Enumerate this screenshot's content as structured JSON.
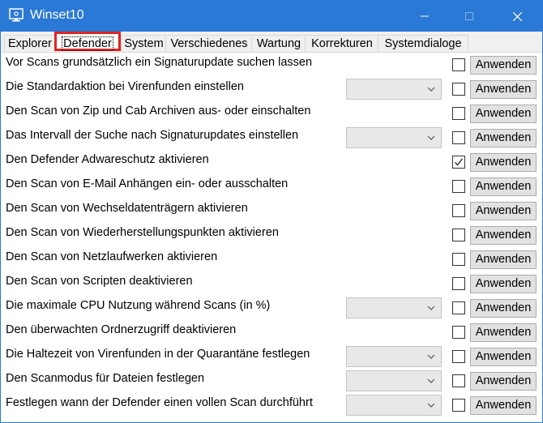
{
  "window": {
    "title": "Winset10",
    "accent_color": "#2b79d6",
    "controls": {
      "minimize": "minimize-icon",
      "maximize": "maximize-icon",
      "close": "close-icon"
    }
  },
  "tabs": [
    {
      "label": "Explorer",
      "selected": false
    },
    {
      "label": "Defender",
      "selected": true
    },
    {
      "label": "System",
      "selected": false
    },
    {
      "label": "Verschiedenes",
      "selected": false
    },
    {
      "label": "Wartung",
      "selected": false
    },
    {
      "label": "Korrekturen",
      "selected": false
    },
    {
      "label": "Systemdialoge",
      "selected": false
    }
  ],
  "highlight_color": "#e02323",
  "settings": [
    {
      "label": "Vor Scans grundsätzlich ein Signaturupdate suchen lassen",
      "has_dropdown": false,
      "checked": false,
      "button": "Anwenden"
    },
    {
      "label": "Die Standardaktion bei Virenfunden einstellen",
      "has_dropdown": true,
      "checked": false,
      "button": "Anwenden"
    },
    {
      "label": "Den Scan von Zip und Cab Archiven aus- oder einschalten",
      "has_dropdown": false,
      "checked": false,
      "button": "Anwenden"
    },
    {
      "label": "Das Intervall der Suche nach Signaturupdates einstellen",
      "has_dropdown": true,
      "checked": false,
      "button": "Anwenden"
    },
    {
      "label": "Den Defender Adwareschutz aktivieren",
      "has_dropdown": false,
      "checked": true,
      "button": "Anwenden"
    },
    {
      "label": "Den Scan von E-Mail Anhängen ein- oder ausschalten",
      "has_dropdown": false,
      "checked": false,
      "button": "Anwenden"
    },
    {
      "label": "Den Scan von Wechseldatenträgern aktivieren",
      "has_dropdown": false,
      "checked": false,
      "button": "Anwenden"
    },
    {
      "label": "Den Scan von Wiederherstellungspunkten aktivieren",
      "has_dropdown": false,
      "checked": false,
      "button": "Anwenden"
    },
    {
      "label": "Den Scan von Netzlaufwerken aktivieren",
      "has_dropdown": false,
      "checked": false,
      "button": "Anwenden"
    },
    {
      "label": "Den Scan von Scripten deaktivieren",
      "has_dropdown": false,
      "checked": false,
      "button": "Anwenden"
    },
    {
      "label": "Die maximale CPU Nutzung während Scans (in %)",
      "has_dropdown": true,
      "checked": false,
      "button": "Anwenden"
    },
    {
      "label": "Den überwachten Ordnerzugriff deaktivieren",
      "has_dropdown": false,
      "checked": false,
      "button": "Anwenden"
    },
    {
      "label": "Die Haltezeit von Virenfunden in der Quarantäne festlegen",
      "has_dropdown": true,
      "checked": false,
      "button": "Anwenden"
    },
    {
      "label": "Den Scanmodus für Dateien festlegen",
      "has_dropdown": true,
      "checked": false,
      "button": "Anwenden"
    },
    {
      "label": "Festlegen wann der Defender einen vollen Scan durchführt",
      "has_dropdown": true,
      "checked": false,
      "button": "Anwenden"
    }
  ]
}
